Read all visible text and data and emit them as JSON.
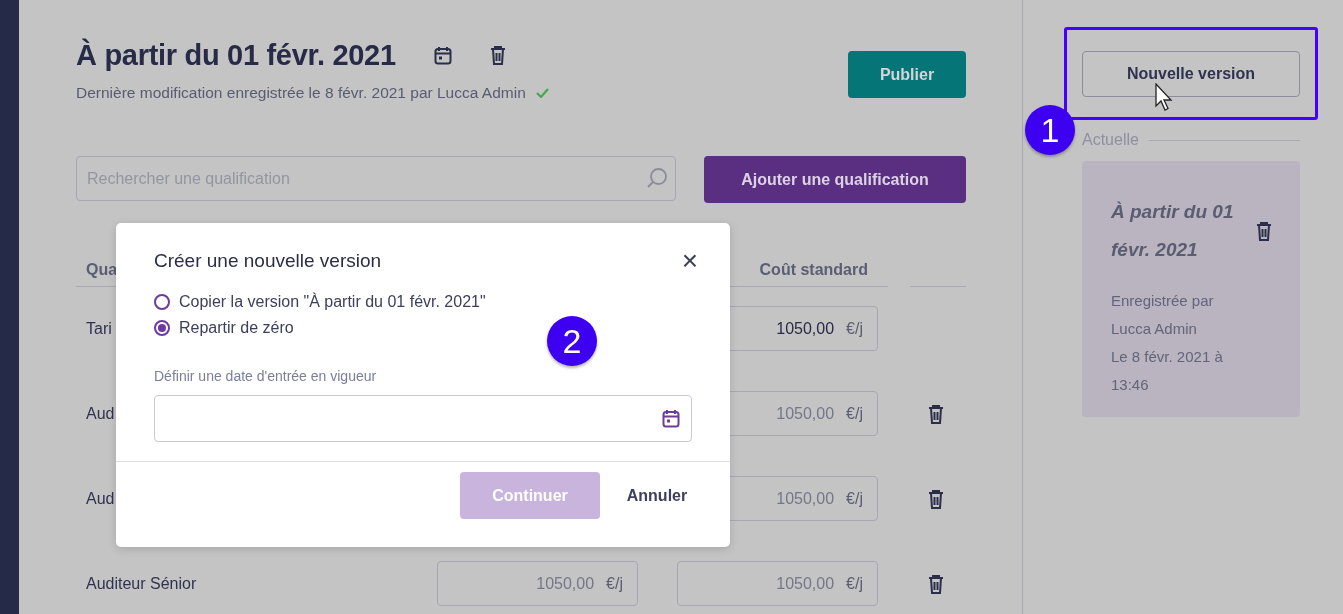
{
  "header": {
    "title": "À partir du 01 févr. 2021",
    "last_saved": "Dernière modification enregistrée le 8 févr. 2021 par Lucca Admin",
    "saved": true,
    "publish_button": "Publier"
  },
  "search": {
    "placeholder": "Rechercher une qualification"
  },
  "add_button": "Ajouter une qualification",
  "table": {
    "columns": [
      "Qua",
      "Coût standard"
    ],
    "rows": [
      {
        "name": "Tari",
        "standard_cost": {
          "value": "1050,00",
          "unit": "€/j",
          "disabled": false
        },
        "deletable": false
      },
      {
        "name": "Aud",
        "standard_cost": {
          "value": "1050,00",
          "unit": "€/j",
          "disabled": true
        },
        "deletable": true
      },
      {
        "name": "Aud",
        "standard_cost": {
          "value": "1050,00",
          "unit": "€/j",
          "disabled": true
        },
        "deletable": true
      },
      {
        "name": "Auditeur Sénior",
        "price": {
          "value": "1050,00",
          "unit": "€/j",
          "disabled": true
        },
        "standard_cost": {
          "value": "1050,00",
          "unit": "€/j",
          "disabled": true
        },
        "deletable": true
      }
    ]
  },
  "sidebar": {
    "new_version_button": "Nouvelle version",
    "section_label": "Actuelle",
    "versions": [
      {
        "title": "À partir du 01 févr. 2021",
        "saved_by": "Enregistrée par Lucca Admin",
        "saved_at": "Le 8 févr. 2021 à 13:46",
        "selected": true
      }
    ]
  },
  "modal": {
    "title": "Créer une nouvelle version",
    "close": "×",
    "options": [
      {
        "label": "Copier la version \"À partir du 01 févr. 2021\"",
        "selected": false
      },
      {
        "label": "Repartir de zéro",
        "selected": true
      }
    ],
    "date_label": "Définir une date d'entrée en vigueur",
    "confirm_button": {
      "label": "Continuer",
      "disabled": true
    },
    "cancel_button": "Annuler"
  },
  "annotations": [
    {
      "label": "1"
    },
    {
      "label": "2"
    }
  ]
}
